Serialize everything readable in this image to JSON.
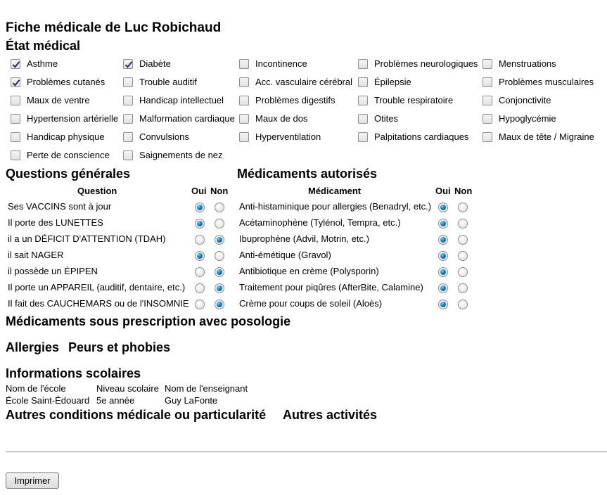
{
  "page": {
    "title": "Fiche médicale de Luc Robichaud",
    "print_button": "Imprimer"
  },
  "etat_medical": {
    "heading": "État médical",
    "conditions": [
      {
        "label": "Asthme",
        "checked": true
      },
      {
        "label": "Diabète",
        "checked": true
      },
      {
        "label": "Incontinence",
        "checked": false
      },
      {
        "label": "Problèmes neurologiques",
        "checked": false
      },
      {
        "label": "Menstruations",
        "checked": false
      },
      {
        "label": "Problèmes cutanés",
        "checked": true
      },
      {
        "label": "Trouble auditif",
        "checked": false
      },
      {
        "label": "Acc. vasculaire cérébral",
        "checked": false
      },
      {
        "label": "Épilepsie",
        "checked": false
      },
      {
        "label": "Problèmes musculaires",
        "checked": false
      },
      {
        "label": "Maux de ventre",
        "checked": false
      },
      {
        "label": "Handicap intellectuel",
        "checked": false
      },
      {
        "label": "Problèmes digestifs",
        "checked": false
      },
      {
        "label": "Trouble respiratoire",
        "checked": false
      },
      {
        "label": "Conjonctivite",
        "checked": false
      },
      {
        "label": "Hypertension artérielle",
        "checked": false
      },
      {
        "label": "Malformation cardiaque",
        "checked": false
      },
      {
        "label": "Maux de dos",
        "checked": false
      },
      {
        "label": "Otites",
        "checked": false
      },
      {
        "label": "Hypoglycémie",
        "checked": false
      },
      {
        "label": "Handicap physique",
        "checked": false
      },
      {
        "label": "Convulsions",
        "checked": false
      },
      {
        "label": "Hyperventilation",
        "checked": false
      },
      {
        "label": "Palpitations cardiaques",
        "checked": false
      },
      {
        "label": "Maux de tête / Migraine",
        "checked": false
      },
      {
        "label": "Perte de conscience",
        "checked": false
      },
      {
        "label": "Saignements de nez",
        "checked": false
      }
    ]
  },
  "questions": {
    "heading": "Questions générales",
    "col_question": "Question",
    "col_oui": "Oui",
    "col_non": "Non",
    "rows": [
      {
        "label": "Ses VACCINS sont à jour",
        "answer": "oui"
      },
      {
        "label": "Il porte des LUNETTES",
        "answer": "oui"
      },
      {
        "label": "il a un DÉFICIT D'ATTENTION (TDAH)",
        "answer": "non"
      },
      {
        "label": "il sait NAGER",
        "answer": "oui"
      },
      {
        "label": "il possède un ÉPIPEN",
        "answer": "non"
      },
      {
        "label": "Il porte un APPAREIL (auditif, dentaire, etc.)",
        "answer": "non"
      },
      {
        "label": "Il fait des CAUCHEMARS ou de l'INSOMNIE",
        "answer": "non"
      }
    ]
  },
  "medicaments": {
    "heading": "Médicaments autorisés",
    "col_medicament": "Médicament",
    "col_oui": "Oui",
    "col_non": "Non",
    "rows": [
      {
        "label": "Anti-histaminique pour allergies (Benadryl, etc.)",
        "answer": "oui"
      },
      {
        "label": "Acétaminophène (Tylénol, Tempra, etc.)",
        "answer": "oui"
      },
      {
        "label": "Ibuprophène (Advil, Motrin, etc.)",
        "answer": "oui"
      },
      {
        "label": "Anti-émétique (Gravol)",
        "answer": "oui"
      },
      {
        "label": "Antibiotique en crème (Polysporin)",
        "answer": "oui"
      },
      {
        "label": "Traitement pour piqûres (AfterBite, Calamine)",
        "answer": "oui"
      },
      {
        "label": "Crème pour coups de soleil (Aloès)",
        "answer": "oui"
      }
    ]
  },
  "prescription": {
    "heading": "Médicaments sous prescription avec posologie"
  },
  "allergies": {
    "heading": "Allergies"
  },
  "peurs": {
    "heading": "Peurs et phobies"
  },
  "scolaire": {
    "heading": "Informations scolaires",
    "headers": [
      "Nom de l'école",
      "Niveau scolaire",
      "Nom de l'enseignant"
    ],
    "values": [
      "École Saint-Édouard",
      "5e année",
      "Guy LaFonte"
    ]
  },
  "autres_conditions": {
    "heading": "Autres conditions médicale ou particularité"
  },
  "autres_activites": {
    "heading": "Autres activités"
  }
}
